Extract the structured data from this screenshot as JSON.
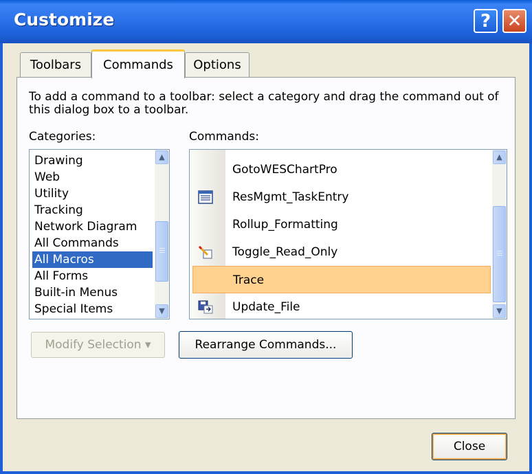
{
  "window": {
    "title": "Customize",
    "help_glyph": "?",
    "close_glyph": "✕"
  },
  "tabs": [
    {
      "label": "Toolbars",
      "active": false
    },
    {
      "label": "Commands",
      "active": true
    },
    {
      "label": "Options",
      "active": false
    }
  ],
  "instructions": "To add a command to a toolbar: select a category and drag the command out of this dialog box to a toolbar.",
  "categories": {
    "label": "Categories:",
    "items": [
      "Drawing",
      "Web",
      "Utility",
      "Tracking",
      "Network Diagram",
      "All Commands",
      "All Macros",
      "All Forms",
      "Built-in Menus",
      "Special Items"
    ],
    "selected": "All Macros"
  },
  "commands": {
    "label": "Commands:",
    "items": [
      {
        "label": "GotoWESChartPro",
        "icon": "none"
      },
      {
        "label": "ResMgmt_TaskEntry",
        "icon": "form-icon"
      },
      {
        "label": "Rollup_Formatting",
        "icon": "none"
      },
      {
        "label": "Toggle_Read_Only",
        "icon": "edit-pencil-icon"
      },
      {
        "label": "Trace",
        "icon": "none"
      },
      {
        "label": "Update_File",
        "icon": "save-file-icon"
      }
    ],
    "selected": "Trace"
  },
  "buttons": {
    "modify_selection": "Modify Selection ▾",
    "rearrange": "Rearrange Commands...",
    "close": "Close"
  },
  "colors": {
    "titlebar": "#2c73ea",
    "selection_blue": "#316ac5",
    "selection_orange": "#ffd290",
    "dialog_bg": "#ece9d8"
  }
}
